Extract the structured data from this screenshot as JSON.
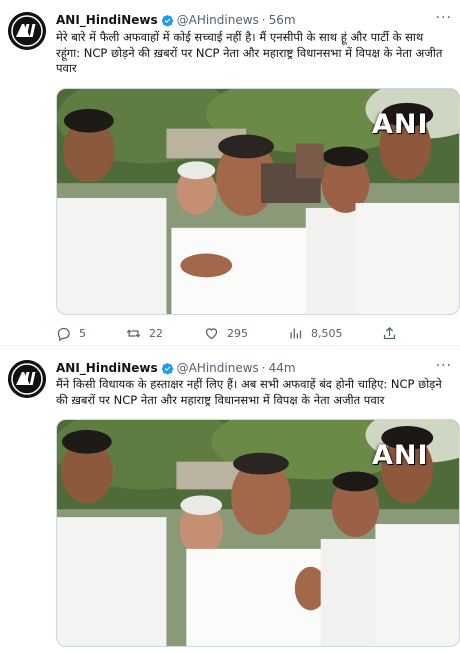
{
  "colors": {
    "accent": "#1d9bf0",
    "text": "#0f1419",
    "muted": "#536471"
  },
  "tweets": [
    {
      "author_name": "ANI_HindiNews",
      "handle": "@AHindinews",
      "separator": "·",
      "time": "56m",
      "text": "मेरे बारे में फैली अफवाहों में कोई सच्चाई नहीं है। मैं एनसीपी के साथ हूं और पार्टी के साथ रहूंगा: NCP छोड़ने की ख़बरों पर NCP नेता और महाराष्ट्र विधानसभा में विपक्ष के नेता अजीत पवार",
      "media_watermark": "ANI",
      "stats": {
        "replies": "5",
        "retweets": "22",
        "likes": "295",
        "views": "8,505"
      }
    },
    {
      "author_name": "ANI_HindiNews",
      "handle": "@AHindinews",
      "separator": "·",
      "time": "44m",
      "text": "मैंने किसी विधायक के हस्ताक्षर नहीं लिए हैं। अब सभी अफवाहें बंद होनी चाहिए: NCP छोड़ने की ख़बरों पर NCP नेता और महाराष्ट्र विधानसभा में विपक्ष के नेता अजीत पवार",
      "media_watermark": "ANI"
    }
  ]
}
